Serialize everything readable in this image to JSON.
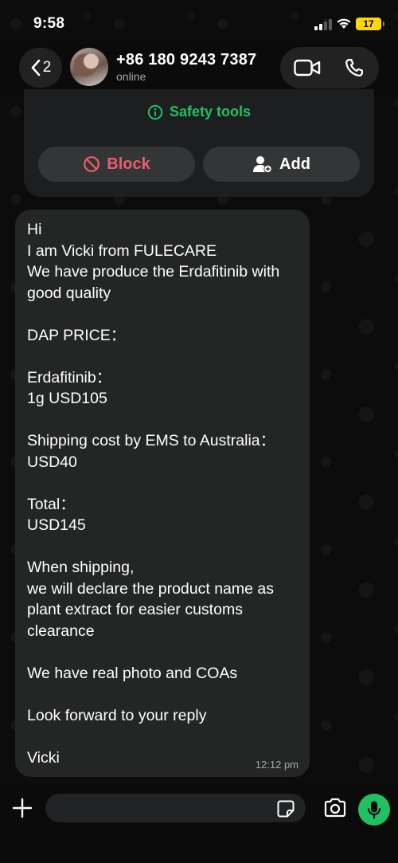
{
  "status_bar": {
    "time": "9:58",
    "battery": "17"
  },
  "header": {
    "back_count": "2",
    "contact_name": "+86 180 9243 7387",
    "contact_status": "online"
  },
  "top_card": {
    "safety_label": "Safety tools",
    "block_label": "Block",
    "add_label": "Add"
  },
  "message": {
    "text": "Hi\nI am Vicki from FULECARE\nWe have produce the Erdafitinib with good quality\n\nDAP PRICE：\n\nErdafitinib：\n1g USD105\n\nShipping cost by EMS to Australia：\nUSD40\n\nTotal：\nUSD145\n\nWhen shipping,\nwe will declare the product name as plant extract for easier customs clearance\n\nWe have real photo and COAs\n\nLook forward to your reply\n\nVicki",
    "time": "12:12 pm"
  },
  "input": {
    "value": "",
    "placeholder": ""
  },
  "colors": {
    "accent_green": "#21c063",
    "danger_red": "#f15c6d",
    "bubble": "#242626",
    "battery_yellow": "#ffd60a"
  },
  "icons": [
    "chevron-left-icon",
    "video-camera-icon",
    "phone-icon",
    "info-circle-icon",
    "block-icon",
    "add-contact-icon",
    "plus-icon",
    "sticker-icon",
    "camera-icon",
    "microphone-icon",
    "signal-icon",
    "wifi-icon",
    "battery-icon"
  ]
}
